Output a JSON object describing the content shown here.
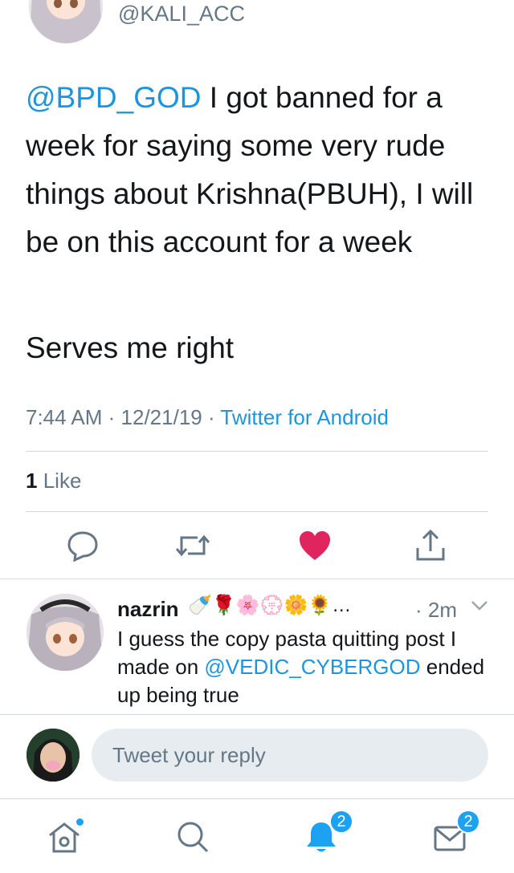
{
  "tweet": {
    "handle": "@KALI_ACC",
    "mention": "@BPD_GOD",
    "text": " I got banned for a week for saying some very rude things about Krishna(PBUH), I will be on this account for a week",
    "text2": "Serves me right",
    "time": "7:44 AM",
    "date": "12/21/19",
    "source": "Twitter for Android",
    "like_count": "1",
    "like_label": "Like"
  },
  "reply": {
    "name": "nazrin",
    "emojis": "🍼🌹🌸💮🌼🌻…",
    "time": "· 2m",
    "text_before": "I guess the copy pasta quitting post I made on ",
    "mention": "@VEDIC_CYBERGOD",
    "text_after": " ended up being true"
  },
  "composer": {
    "placeholder": "Tweet your reply"
  },
  "tabbar": {
    "notifications_badge": "2",
    "messages_badge": "2"
  },
  "colors": {
    "accent": "#1da1f2",
    "link": "#1b95e0",
    "like": "#e0245e",
    "muted": "#657786"
  }
}
